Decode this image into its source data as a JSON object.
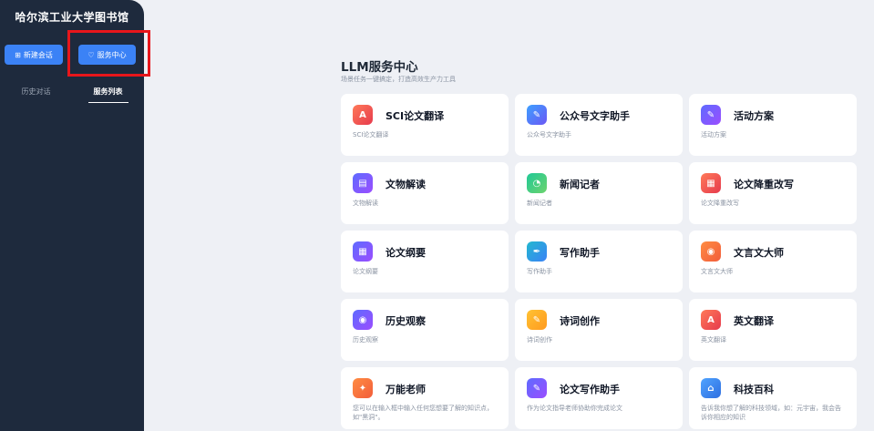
{
  "sidebar": {
    "brand": "哈尔滨工业大学图书馆",
    "new_chat": "新建会话",
    "service_center": "服务中心",
    "tabs": [
      "历史对话",
      "服务列表"
    ]
  },
  "main": {
    "title": "LLM服务中心",
    "subtitle": "场景任务一键搞定，打造高效生产力工具",
    "cards": [
      {
        "name": "SCI论文翻译",
        "desc": "SCI论文翻译",
        "icon": "document-translate-icon"
      },
      {
        "name": "公众号文字助手",
        "desc": "公众号文字助手",
        "icon": "pen-icon"
      },
      {
        "name": "活动方案",
        "desc": "活动方案",
        "icon": "plan-icon"
      },
      {
        "name": "文物解读",
        "desc": "文物解读",
        "icon": "artifact-icon"
      },
      {
        "name": "新闻记者",
        "desc": "新闻记者",
        "icon": "news-icon"
      },
      {
        "name": "论文降重改写",
        "desc": "论文降重改写",
        "icon": "rewrite-icon"
      },
      {
        "name": "论文纲要",
        "desc": "论文纲要",
        "icon": "outline-icon"
      },
      {
        "name": "写作助手",
        "desc": "写作助手",
        "icon": "writing-icon"
      },
      {
        "name": "文言文大师",
        "desc": "文言文大师",
        "icon": "classical-chinese-icon"
      },
      {
        "name": "历史观察",
        "desc": "历史观察",
        "icon": "eye-icon"
      },
      {
        "name": "诗词创作",
        "desc": "诗词创作",
        "icon": "poetry-icon"
      },
      {
        "name": "英文翻译",
        "desc": "英文翻译",
        "icon": "translate-icon"
      },
      {
        "name": "万能老师",
        "desc": "您可以在输入框中输入任何您想要了解的知识点，如\"黑洞\"。",
        "icon": "teacher-icon"
      },
      {
        "name": "论文写作助手",
        "desc": "作为论文指导老师协助你完成论文",
        "icon": "paper-writing-icon"
      },
      {
        "name": "科技百科",
        "desc": "告诉我你想了解的科技领域，如：元宇宙，我会告诉你相应的知识",
        "icon": "encyclopedia-icon"
      }
    ]
  },
  "colors": {
    "sidebar_bg": "#1e2a3d",
    "accent": "#3b82f6",
    "highlight": "#e8161b",
    "page_bg": "#eef0f5"
  }
}
